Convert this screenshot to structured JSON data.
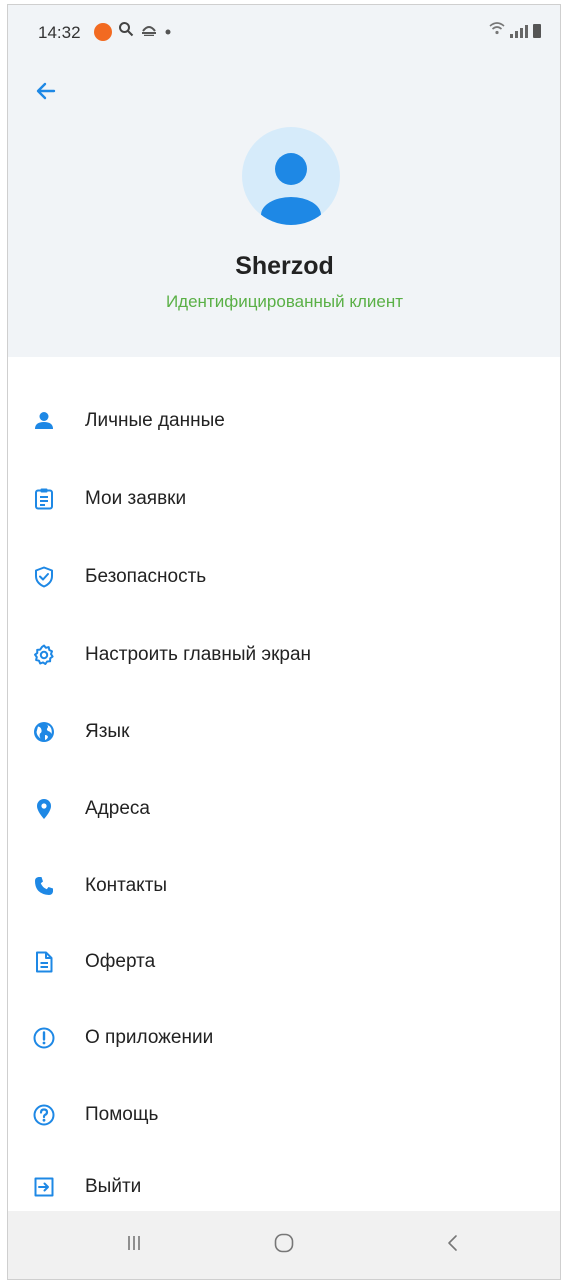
{
  "status_bar": {
    "time": "14:32",
    "left_icons": [
      "notification-dot-icon",
      "search-icon",
      "weather-icon",
      "dot-icon"
    ],
    "right_icons": [
      "wifi-icon",
      "signal-icon",
      "battery-icon"
    ]
  },
  "header": {
    "back_icon": "arrow-left-icon",
    "user_name": "Sherzod",
    "user_status": "Идентифицированный клиент"
  },
  "menu": {
    "items": [
      {
        "label": "Личные данные",
        "icon": "person-icon"
      },
      {
        "label": "Мои заявки",
        "icon": "clipboard-icon"
      },
      {
        "label": "Безопасность",
        "icon": "shield-check-icon"
      },
      {
        "label": "Настроить главный экран",
        "icon": "gear-icon"
      },
      {
        "label": "Язык",
        "icon": "globe-icon"
      },
      {
        "label": "Адреса",
        "icon": "location-pin-icon"
      },
      {
        "label": "Контакты",
        "icon": "phone-icon"
      },
      {
        "label": "Оферта",
        "icon": "document-icon"
      },
      {
        "label": "О приложении",
        "icon": "info-circle-icon"
      },
      {
        "label": "Помощь",
        "icon": "help-circle-icon"
      },
      {
        "label": "Выйти",
        "icon": "logout-icon"
      }
    ]
  },
  "nav_bar": {
    "buttons": [
      "recent-apps-icon",
      "home-icon",
      "back-icon"
    ]
  },
  "colors": {
    "accent": "#1e88e5",
    "status_green": "#5ab046",
    "header_bg": "#f1f4f7",
    "avatar_bg": "#d6ebfa"
  }
}
